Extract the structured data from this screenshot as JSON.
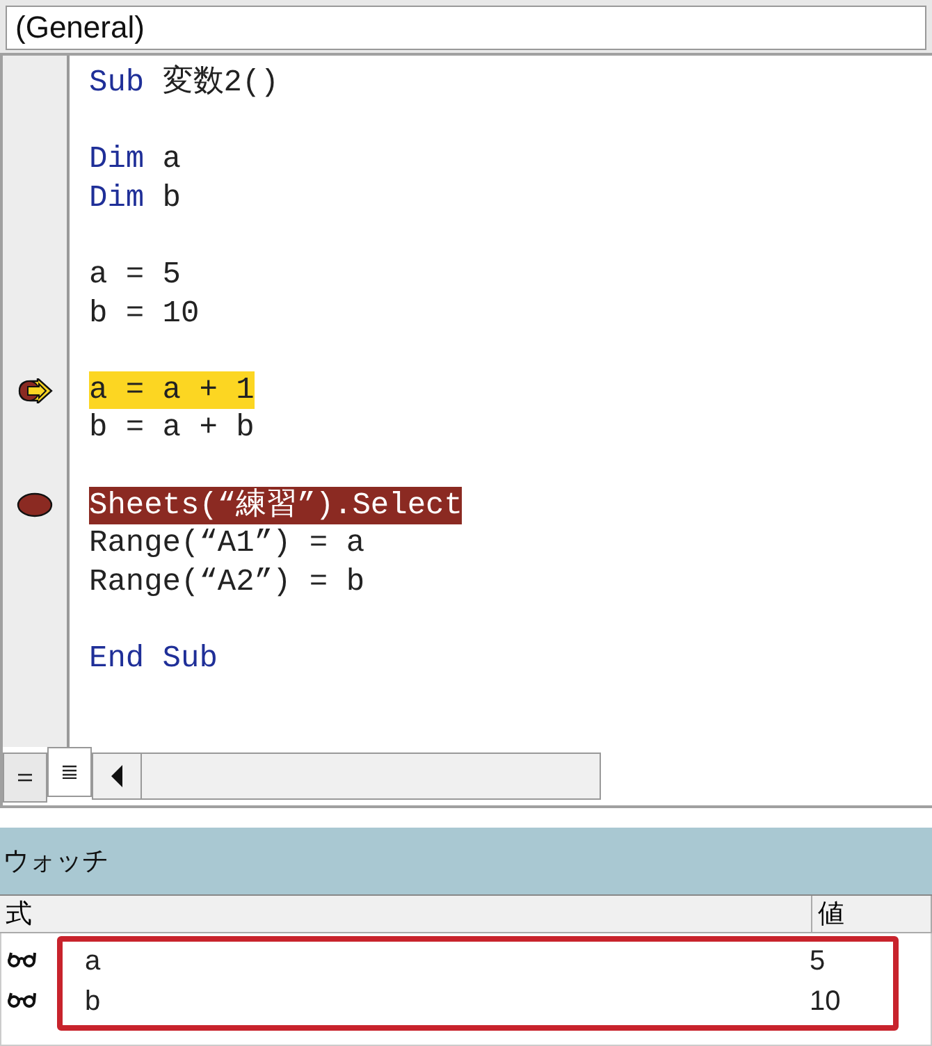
{
  "object_box": {
    "value": "(General)"
  },
  "code_lines": [
    {
      "kind": "code",
      "current": false,
      "breakpoint": false,
      "tokens": [
        {
          "text": "Sub",
          "kind": "keyword"
        },
        {
          "text": " 変数2()",
          "kind": "plain"
        }
      ]
    },
    {
      "kind": "blank"
    },
    {
      "kind": "code",
      "current": false,
      "breakpoint": false,
      "tokens": [
        {
          "text": "Dim",
          "kind": "keyword"
        },
        {
          "text": " a",
          "kind": "plain"
        }
      ]
    },
    {
      "kind": "code",
      "current": false,
      "breakpoint": false,
      "tokens": [
        {
          "text": "Dim",
          "kind": "keyword"
        },
        {
          "text": " b",
          "kind": "plain"
        }
      ]
    },
    {
      "kind": "blank"
    },
    {
      "kind": "code",
      "current": false,
      "breakpoint": false,
      "tokens": [
        {
          "text": "a = 5",
          "kind": "plain"
        }
      ]
    },
    {
      "kind": "code",
      "current": false,
      "breakpoint": false,
      "tokens": [
        {
          "text": "b = 10",
          "kind": "plain"
        }
      ]
    },
    {
      "kind": "blank"
    },
    {
      "kind": "code",
      "current": true,
      "breakpoint": false,
      "tokens": [
        {
          "text": "a = a + 1",
          "kind": "plain"
        }
      ]
    },
    {
      "kind": "code",
      "current": false,
      "breakpoint": false,
      "tokens": [
        {
          "text": "b = a + b",
          "kind": "plain"
        }
      ]
    },
    {
      "kind": "blank"
    },
    {
      "kind": "code",
      "current": false,
      "breakpoint": true,
      "tokens": [
        {
          "text": "Sheets(“練習”).Select",
          "kind": "plain"
        }
      ]
    },
    {
      "kind": "code",
      "current": false,
      "breakpoint": false,
      "tokens": [
        {
          "text": "Range(“A1”) = a",
          "kind": "plain"
        }
      ]
    },
    {
      "kind": "code",
      "current": false,
      "breakpoint": false,
      "tokens": [
        {
          "text": "Range(“A2”) = b",
          "kind": "plain"
        }
      ]
    },
    {
      "kind": "blank"
    },
    {
      "kind": "code",
      "current": false,
      "breakpoint": false,
      "tokens": [
        {
          "text": "End Sub",
          "kind": "keyword"
        }
      ]
    }
  ],
  "view_buttons": [
    {
      "selected": false
    },
    {
      "selected": true
    }
  ],
  "watch": {
    "title": "ウォッチ",
    "columns": [
      "式",
      "値"
    ],
    "rows": [
      {
        "expression": "a",
        "value": "5"
      },
      {
        "expression": "b",
        "value": "10"
      }
    ]
  }
}
